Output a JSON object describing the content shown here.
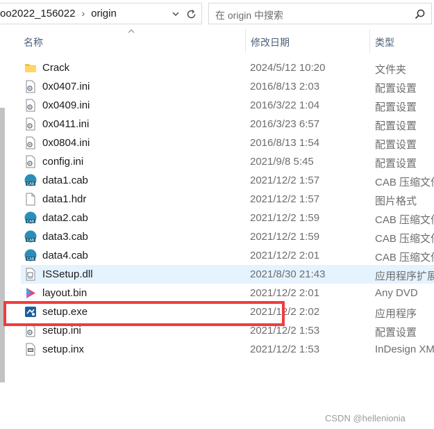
{
  "address": {
    "crumbs": [
      "oo2022_156022",
      "origin"
    ]
  },
  "search": {
    "placeholder": "在 origin 中搜索"
  },
  "headers": {
    "name": "名称",
    "date": "修改日期",
    "type": "类型"
  },
  "files": [
    {
      "name": "Crack",
      "date": "2024/5/12 10:20",
      "type": "文件夹",
      "icon": "folder-icon"
    },
    {
      "name": "0x0407.ini",
      "date": "2016/8/13 2:03",
      "type": "配置设置",
      "icon": "ini-file-icon"
    },
    {
      "name": "0x0409.ini",
      "date": "2016/3/22 1:04",
      "type": "配置设置",
      "icon": "ini-file-icon"
    },
    {
      "name": "0x0411.ini",
      "date": "2016/3/23 6:57",
      "type": "配置设置",
      "icon": "ini-file-icon"
    },
    {
      "name": "0x0804.ini",
      "date": "2016/8/13 1:54",
      "type": "配置设置",
      "icon": "ini-file-icon"
    },
    {
      "name": "config.ini",
      "date": "2021/9/8 5:45",
      "type": "配置设置",
      "icon": "ini-file-icon"
    },
    {
      "name": "data1.cab",
      "date": "2021/12/2 1:57",
      "type": "CAB 压缩文件",
      "icon": "cab-file-icon"
    },
    {
      "name": "data1.hdr",
      "date": "2021/12/2 1:57",
      "type": "图片格式",
      "icon": "blank-file-icon"
    },
    {
      "name": "data2.cab",
      "date": "2021/12/2 1:59",
      "type": "CAB 压缩文件",
      "icon": "cab-file-icon"
    },
    {
      "name": "data3.cab",
      "date": "2021/12/2 1:59",
      "type": "CAB 压缩文件",
      "icon": "cab-file-icon"
    },
    {
      "name": "data4.cab",
      "date": "2021/12/2 2:01",
      "type": "CAB 压缩文件",
      "icon": "cab-file-icon"
    },
    {
      "name": "ISSetup.dll",
      "date": "2021/8/30 21:43",
      "type": "应用程序扩展",
      "icon": "dll-file-icon"
    },
    {
      "name": "layout.bin",
      "date": "2021/12/2 2:01",
      "type": "Any DVD",
      "icon": "bin-file-icon"
    },
    {
      "name": "setup.exe",
      "date": "2021/12/2 2:02",
      "type": "应用程序",
      "icon": "exe-file-icon"
    },
    {
      "name": "setup.ini",
      "date": "2021/12/2 1:53",
      "type": "配置设置",
      "icon": "ini-file-icon"
    },
    {
      "name": "setup.inx",
      "date": "2021/12/2 1:53",
      "type": "InDesign XML",
      "icon": "inx-file-icon"
    }
  ],
  "selected_file": "ISSetup.dll",
  "highlighted_file": "setup.exe",
  "colors": {
    "highlight_box": "#f03c3c",
    "selection": "#e5f3ff",
    "header_text": "#4c607a"
  },
  "watermark": "CSDN @hellenionia"
}
